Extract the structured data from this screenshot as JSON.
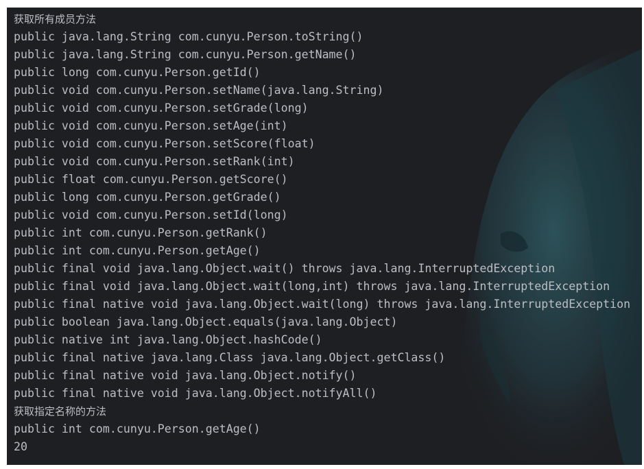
{
  "console": {
    "lines": [
      "获取所有成员方法",
      "public java.lang.String com.cunyu.Person.toString()",
      "public java.lang.String com.cunyu.Person.getName()",
      "public long com.cunyu.Person.getId()",
      "public void com.cunyu.Person.setName(java.lang.String)",
      "public void com.cunyu.Person.setGrade(long)",
      "public void com.cunyu.Person.setAge(int)",
      "public void com.cunyu.Person.setScore(float)",
      "public void com.cunyu.Person.setRank(int)",
      "public float com.cunyu.Person.getScore()",
      "public long com.cunyu.Person.getGrade()",
      "public void com.cunyu.Person.setId(long)",
      "public int com.cunyu.Person.getRank()",
      "public int com.cunyu.Person.getAge()",
      "public final void java.lang.Object.wait() throws java.lang.InterruptedException",
      "public final void java.lang.Object.wait(long,int) throws java.lang.InterruptedException",
      "public final native void java.lang.Object.wait(long) throws java.lang.InterruptedException",
      "public boolean java.lang.Object.equals(java.lang.Object)",
      "public native int java.lang.Object.hashCode()",
      "public final native java.lang.Class java.lang.Object.getClass()",
      "public final native void java.lang.Object.notify()",
      "public final native void java.lang.Object.notifyAll()",
      "获取指定名称的方法",
      "public int com.cunyu.Person.getAge()",
      "20"
    ]
  },
  "colors": {
    "background": "#1e1f22",
    "text": "#bcbec4",
    "art": "#2a4a52"
  }
}
